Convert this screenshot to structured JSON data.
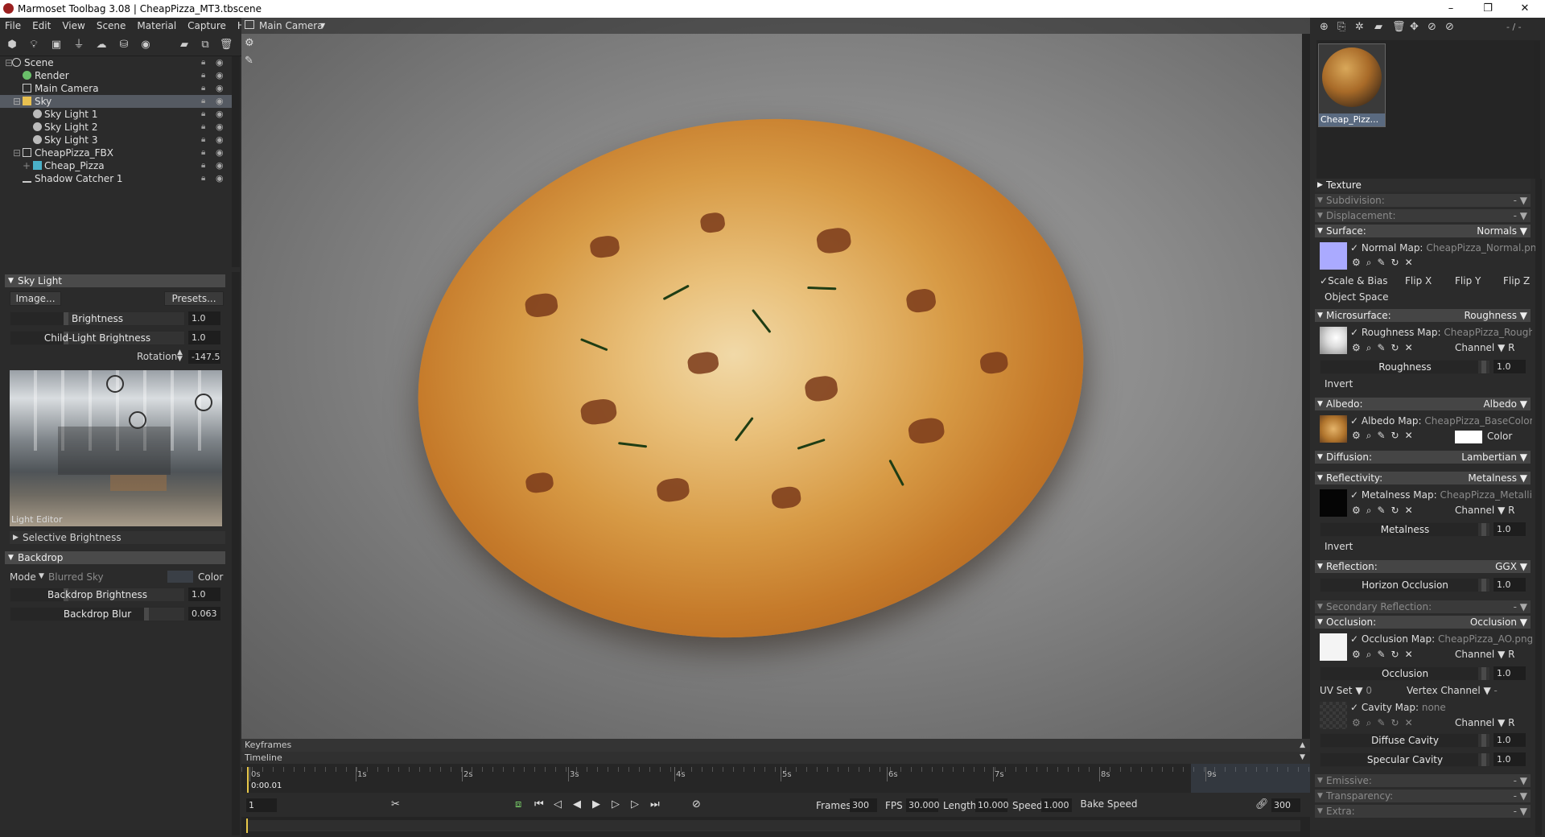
{
  "window": {
    "title": "Marmoset Toolbag 3.08  |  CheapPizza_MT3.tbscene",
    "minimize": "–",
    "restore": "❐",
    "close": "✕"
  },
  "menu": [
    "File",
    "Edit",
    "View",
    "Scene",
    "Material",
    "Capture",
    "Help"
  ],
  "scene_tree": {
    "items": [
      {
        "label": "Scene"
      },
      {
        "label": "Render"
      },
      {
        "label": "Main Camera"
      },
      {
        "label": "Sky"
      },
      {
        "label": "Sky Light 1"
      },
      {
        "label": "Sky Light 2"
      },
      {
        "label": "Sky Light 3"
      },
      {
        "label": "CheapPizza_FBX"
      },
      {
        "label": "Cheap_Pizza"
      },
      {
        "label": "Shadow Catcher 1"
      }
    ]
  },
  "sky_light": {
    "header": "Sky Light",
    "image_button": "Image...",
    "presets_button": "Presets...",
    "brightness_label": "Brightness",
    "brightness_value": "1.0",
    "child_brightness_label": "Child-Light Brightness",
    "child_brightness_value": "1.0",
    "rotation_label": "Rotation",
    "rotation_value": "-147.5",
    "light_editor_label": "Light Editor",
    "selective_brightness": "Selective Brightness"
  },
  "backdrop": {
    "header": "Backdrop",
    "mode_label": "Mode",
    "mode_value": "Blurred Sky",
    "color_label": "Color",
    "brightness_label": "Backdrop Brightness",
    "brightness_value": "1.0",
    "blur_label": "Backdrop Blur",
    "blur_value": "0.063"
  },
  "viewport": {
    "camera_label": "Main Camera"
  },
  "timeline": {
    "keyframes_label": "Keyframes",
    "timeline_label": "Timeline",
    "ticks": [
      "0s",
      "1s",
      "2s",
      "3s",
      "4s",
      "5s",
      "6s",
      "7s",
      "8s",
      "9s"
    ],
    "current_time": "0:00.01",
    "frame_field": "1",
    "frames_label": "Frames",
    "frames_value": "300",
    "fps_label": "FPS",
    "fps_value": "30.000",
    "length_label": "Length",
    "length_value": "10.000",
    "speed_label": "Speed",
    "speed_value": "1.000",
    "bake_speed": "Bake Speed",
    "end_frame": "300"
  },
  "material": {
    "thumb_label": "Cheap_Pizz...",
    "pager": "- / -",
    "texture": "Texture",
    "subdivision": "Subdivision:",
    "displacement": "Displacement:",
    "surface": {
      "label": "Surface:",
      "value": "Normals",
      "map_label": "Normal Map:",
      "map_file": "CheapPizza_Normal.png",
      "scale_bias": "Scale & Bias",
      "flip_x": "Flip X",
      "flip_y": "Flip Y",
      "flip_z": "Flip Z",
      "object_space": "Object Space"
    },
    "microsurface": {
      "label": "Microsurface:",
      "value": "Roughness",
      "map_label": "Roughness Map:",
      "map_file": "CheapPizza_Roughness",
      "channel": "Channel",
      "channel_value": "R",
      "param": "Roughness",
      "param_value": "1.0",
      "invert": "Invert"
    },
    "albedo": {
      "label": "Albedo:",
      "value": "Albedo",
      "map_label": "Albedo Map:",
      "map_file": "CheapPizza_BaseColor.png",
      "color": "Color"
    },
    "diffusion": {
      "label": "Diffusion:",
      "value": "Lambertian"
    },
    "reflectivity": {
      "label": "Reflectivity:",
      "value": "Metalness",
      "map_label": "Metalness Map:",
      "map_file": "CheapPizza_Metallic.png",
      "channel": "Channel",
      "channel_value": "R",
      "param": "Metalness",
      "param_value": "1.0",
      "invert": "Invert"
    },
    "reflection": {
      "label": "Reflection:",
      "value": "GGX",
      "horizon": "Horizon Occlusion",
      "horizon_value": "1.0"
    },
    "secondary_reflection": {
      "label": "Secondary Reflection:",
      "value": "-"
    },
    "occlusion": {
      "label": "Occlusion:",
      "value": "Occlusion",
      "map_label": "Occlusion Map:",
      "map_file": "CheapPizza_AO.png",
      "channel": "Channel",
      "channel_value": "R",
      "param": "Occlusion",
      "param_value": "1.0",
      "uv_set": "UV Set",
      "uv_value": "0",
      "vertex_channel": "Vertex Channel",
      "vertex_value": "-",
      "cavity_label": "Cavity Map:",
      "cavity_file": "none",
      "cavity_channel": "Channel",
      "cavity_channel_value": "R",
      "diffuse_cavity": "Diffuse Cavity",
      "diffuse_cavity_value": "1.0",
      "specular_cavity": "Specular Cavity",
      "specular_cavity_value": "1.0"
    },
    "emissive": {
      "label": "Emissive:",
      "value": "-"
    },
    "transparency": {
      "label": "Transparency:",
      "value": "-"
    },
    "extra": {
      "label": "Extra:",
      "value": "-"
    }
  },
  "colors": {
    "accent_selected": "#555a62",
    "normal_swatch": "#aaaaff",
    "albedo_color": "#ffffff"
  }
}
